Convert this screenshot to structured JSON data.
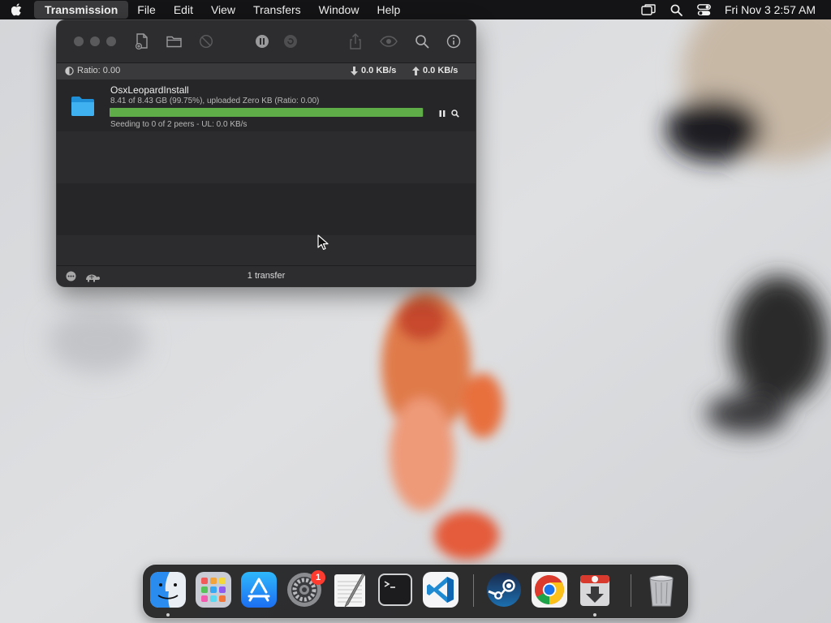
{
  "menubar": {
    "app_name": "Transmission",
    "menus": [
      "File",
      "Edit",
      "View",
      "Transfers",
      "Window",
      "Help"
    ],
    "clock": "Fri Nov 3  2:57 AM"
  },
  "window": {
    "status": {
      "ratio": "Ratio: 0.00",
      "download_speed": "0.0 KB/s",
      "upload_speed": "0.0 KB/s"
    },
    "torrents": [
      {
        "name": "OsxLeopardInstall",
        "progress_text": "8.41 of 8.43 GB (99.75%), uploaded Zero KB (Ratio: 0.00)",
        "progress_fraction": 0.9975,
        "status_text": "Seeding to 0 of 2 peers - UL: 0.0 KB/s"
      }
    ],
    "transfer_count": "1 transfer"
  },
  "dock": {
    "badge_count": "1",
    "apps": [
      "finder",
      "launchpad",
      "app-store",
      "system-settings",
      "textedit",
      "terminal",
      "vscode",
      "steam",
      "chrome",
      "transmission",
      "trash"
    ]
  },
  "colors": {
    "progress_fill": "#5fad49",
    "badge": "#ff3b30",
    "menubar": "#141416"
  }
}
